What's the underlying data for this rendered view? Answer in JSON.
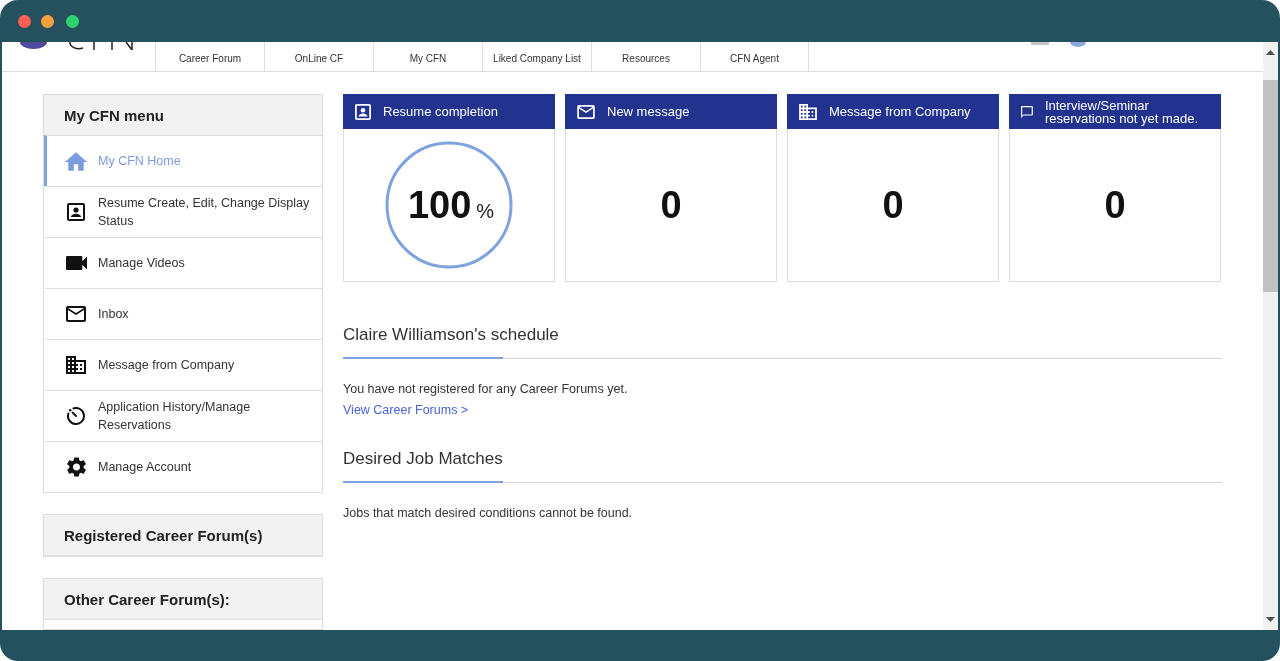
{
  "nav": {
    "tabs": [
      {
        "label": "Career Forum",
        "selected": false
      },
      {
        "label": "OnLine CF",
        "selected": false
      },
      {
        "label": "My CFN",
        "selected": false
      },
      {
        "label": "Liked Company List",
        "selected": false
      },
      {
        "label": "Resources",
        "selected": false
      },
      {
        "label": "CFN Agent",
        "selected": false
      }
    ]
  },
  "sidebar": {
    "menu": {
      "title": "My CFN menu",
      "items": [
        {
          "label": "My CFN Home",
          "selected": true
        },
        {
          "label": "Resume Create, Edit, Change Display Status",
          "selected": false
        },
        {
          "label": "Manage Videos",
          "selected": false
        },
        {
          "label": "Inbox",
          "selected": false
        },
        {
          "label": "Message from Company",
          "selected": false
        },
        {
          "label": "Application History/Manage Reservations",
          "selected": false
        },
        {
          "label": "Manage Account",
          "selected": false
        }
      ]
    },
    "panels": [
      {
        "title": "Registered Career Forum(s)",
        "expanded": false
      },
      {
        "title": "Other Career Forum(s):",
        "expanded": true
      }
    ]
  },
  "cards": [
    {
      "kind": "ring",
      "title": "Resume completion",
      "value": "100",
      "unit": "%",
      "level": 1
    },
    {
      "kind": "count",
      "title": "New message",
      "value": "0"
    },
    {
      "kind": "count",
      "title": "Message from Company",
      "value": "0"
    },
    {
      "kind": "count",
      "title": "Interview/Seminar reservations not yet made.",
      "value": "0"
    }
  ],
  "schedule": {
    "heading": "Claire Williamson's schedule",
    "message": "You have not registered for any Career Forums yet.",
    "link": "View Career Forums >"
  },
  "job_matches": {
    "heading": "Desired Job Matches",
    "message": "Jobs that match desired conditions cannot be found."
  }
}
